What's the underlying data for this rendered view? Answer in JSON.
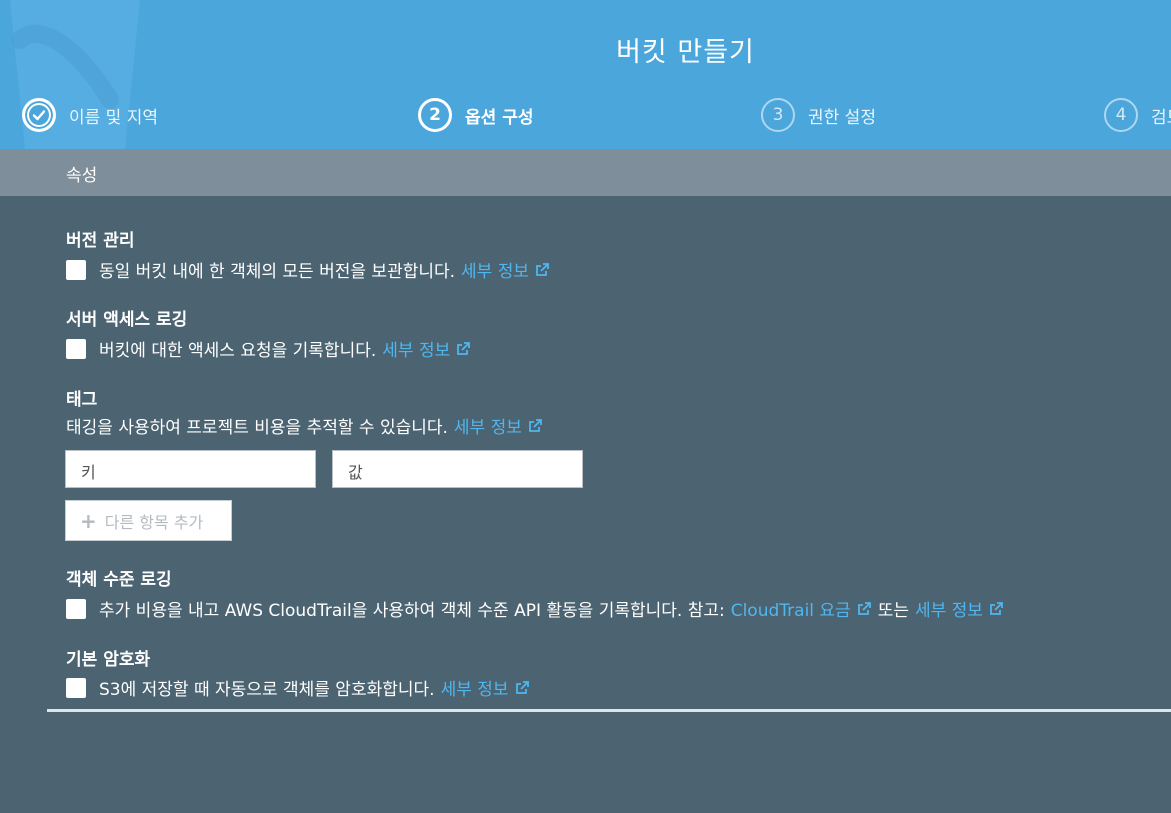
{
  "header": {
    "title": "버킷 만들기",
    "steps": [
      {
        "number": "",
        "label": "이름 및 지역",
        "state": "done"
      },
      {
        "number": "2",
        "label": "옵션 구성",
        "state": "active"
      },
      {
        "number": "3",
        "label": "권한 설정",
        "state": "pending"
      },
      {
        "number": "4",
        "label": "검토",
        "state": "pending"
      }
    ]
  },
  "section": {
    "title": "속성"
  },
  "versioning": {
    "title": "버전 관리",
    "text": "동일 버킷 내에 한 객체의 모든 버전을 보관합니다.",
    "link": "세부 정보",
    "checked": false
  },
  "logging": {
    "title": "서버 액세스 로깅",
    "text": "버킷에 대한 액세스 요청을 기록합니다.",
    "link": "세부 정보",
    "checked": false
  },
  "tags": {
    "title": "태그",
    "text": "태깅을 사용하여 프로젝트 비용을 추적할 수 있습니다.",
    "link": "세부 정보",
    "key_placeholder": "키",
    "value_placeholder": "값",
    "add_label": "다른 항목 추가"
  },
  "object_logging": {
    "title": "객체 수준 로깅",
    "text": "추가 비용을 내고 AWS CloudTrail을 사용하여 객체 수준 API 활동을 기록합니다. 참고:",
    "pricing_link": "CloudTrail 요금",
    "or_text": "또는",
    "link": "세부 정보",
    "checked": false
  },
  "encryption": {
    "title": "기본 암호화",
    "text": "S3에 저장할 때 자동으로 객체를 암호화합니다.",
    "link": "세부 정보",
    "checked": false
  },
  "colors": {
    "header": "#4ba6dc",
    "section_bar": "#7e8e9a",
    "background": "#4c6372",
    "link": "#4fb7ef"
  }
}
